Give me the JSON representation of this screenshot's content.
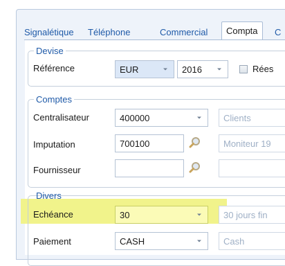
{
  "tabs": [
    {
      "label": "Signalétique",
      "active": false
    },
    {
      "label": "Téléphone",
      "active": false
    },
    {
      "label": "Commercial",
      "active": false
    },
    {
      "label": "Compta",
      "active": true
    },
    {
      "label": "C",
      "active": false
    }
  ],
  "devise": {
    "title": "Devise",
    "reference_label": "Référence",
    "currency_value": "EUR",
    "year_value": "2016",
    "checkbox_label": "Rées"
  },
  "comptes": {
    "title": "Comptes",
    "rows": [
      {
        "label": "Centralisateur",
        "value": "400000",
        "extra": "Clients"
      },
      {
        "label": "Imputation",
        "value": "700100",
        "extra": "Moniteur 19"
      },
      {
        "label": "Fournisseur",
        "value": "",
        "extra": ""
      }
    ]
  },
  "divers": {
    "title": "Divers",
    "rows": [
      {
        "label": "Echéance",
        "value": "30",
        "extra": "30 jours fin"
      },
      {
        "label": "Paiement",
        "value": "CASH",
        "extra": "Cash"
      }
    ]
  },
  "colors": {
    "tab_link": "#1f5aa8",
    "highlight": "#f1f38b",
    "disabled_text": "#9fb0c6"
  }
}
